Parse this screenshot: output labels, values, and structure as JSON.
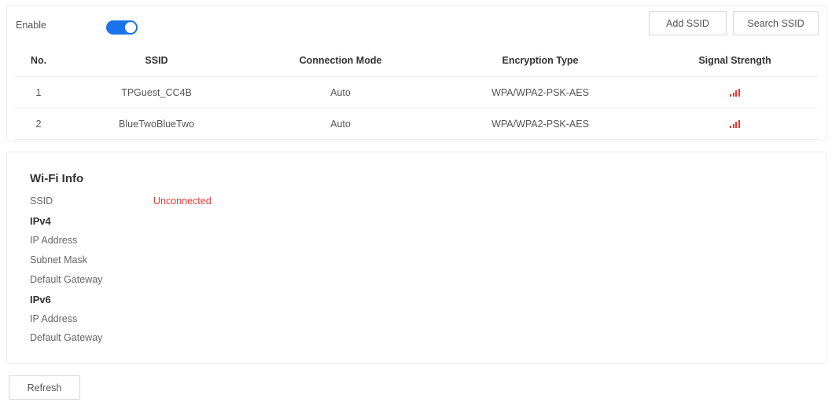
{
  "toolbar": {
    "enable_label": "Enable",
    "enable_on": true,
    "add_ssid_label": "Add SSID",
    "search_ssid_label": "Search SSID"
  },
  "table": {
    "columns": [
      "No.",
      "SSID",
      "Connection Mode",
      "Encryption Type",
      "Signal Strength"
    ],
    "rows": [
      {
        "no": "1",
        "ssid": "TPGuest_CC4B",
        "mode": "Auto",
        "encryption": "WPA/WPA2-PSK-AES",
        "signal": "signal-icon"
      },
      {
        "no": "2",
        "ssid": "BlueTwoBlueTwo",
        "mode": "Auto",
        "encryption": "WPA/WPA2-PSK-AES",
        "signal": "signal-icon"
      }
    ]
  },
  "wifi_info": {
    "title": "Wi-Fi Info",
    "ssid_label": "SSID",
    "ssid_value": "Unconnected",
    "ipv4_heading": "IPv4",
    "ipv4_ip_label": "IP Address",
    "ipv4_mask_label": "Subnet Mask",
    "ipv4_gateway_label": "Default Gateway",
    "ipv6_heading": "IPv6",
    "ipv6_ip_label": "IP Address",
    "ipv6_gateway_label": "Default Gateway"
  },
  "footer": {
    "refresh_label": "Refresh"
  },
  "colors": {
    "accent": "#1a73e8",
    "status_red": "#e53935"
  }
}
